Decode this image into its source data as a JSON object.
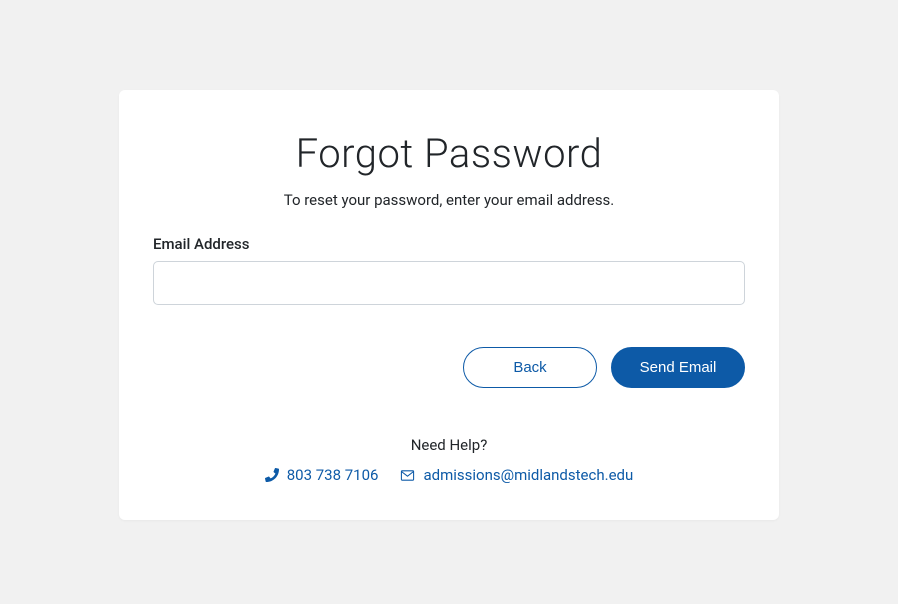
{
  "header": {
    "title": "Forgot Password",
    "subtitle": "To reset your password, enter your email address."
  },
  "form": {
    "email_label": "Email Address",
    "email_value": ""
  },
  "buttons": {
    "back_label": "Back",
    "send_label": "Send Email"
  },
  "help": {
    "title": "Need Help?",
    "phone": "803 738 7106",
    "email": "admissions@midlandstech.edu"
  }
}
